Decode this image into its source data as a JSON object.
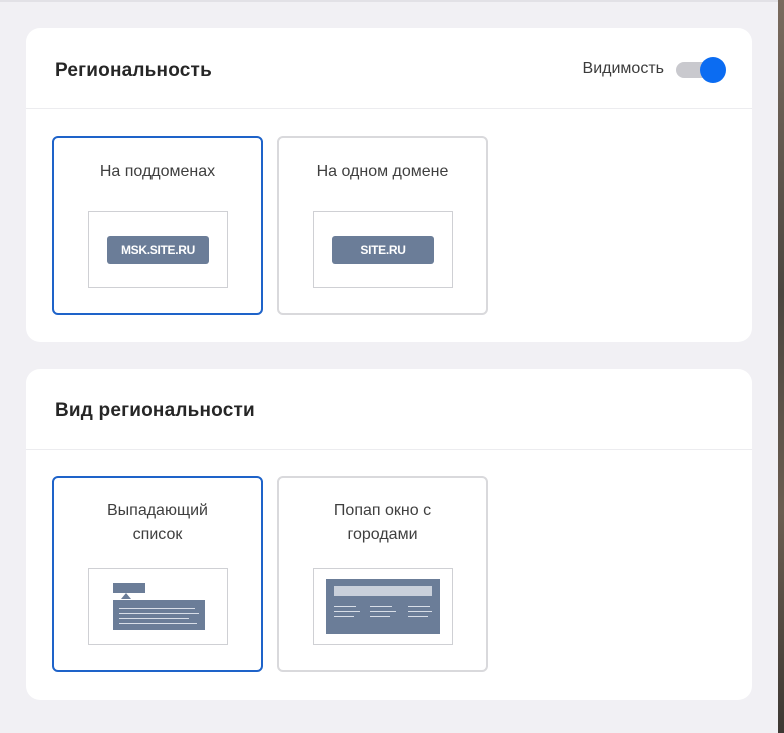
{
  "regionality": {
    "title": "Региональность",
    "visibility_label": "Видимость",
    "visibility_on": true,
    "options": [
      {
        "label": "На поддоменах",
        "preview_text": "MSK.SITE.RU",
        "selected": true
      },
      {
        "label": "На одном домене",
        "preview_text": "SITE.RU",
        "selected": false
      }
    ]
  },
  "view": {
    "title": "Вид региональности",
    "options": [
      {
        "label_line1": "Выпадающий",
        "label_line2": "список",
        "preview": "dropdown",
        "selected": true
      },
      {
        "label_line1": "Попап окно с",
        "label_line2": "городами",
        "preview": "popup",
        "selected": false
      }
    ]
  },
  "colors": {
    "accent": "#0b6cf2",
    "selected_border": "#1e63c9",
    "preview_fill": "#6b7d98",
    "background": "#f1f0f4"
  }
}
